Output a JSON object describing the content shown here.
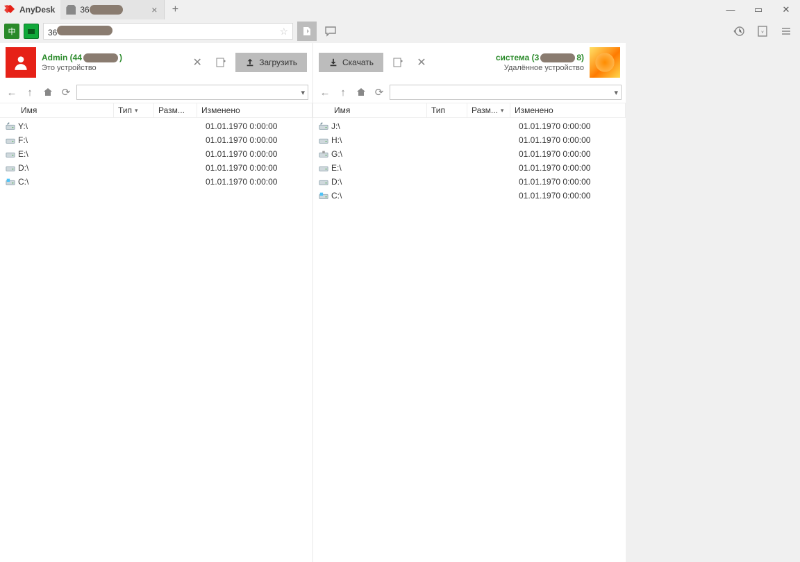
{
  "app_name": "AnyDesk",
  "tab_label_prefix": "36",
  "address_prefix": "36",
  "window_controls": {
    "min": "—",
    "max": "▭",
    "close": "✕"
  },
  "left": {
    "user_name_prefix": "Admin (44",
    "user_name_suffix": ")",
    "device_label": "Это устройство",
    "transfer_label": "Загрузить",
    "columns": {
      "name": "Имя",
      "type": "Тип",
      "size": "Разм...",
      "modified": "Изменено"
    },
    "drives": [
      {
        "name": "Y:\\",
        "kind": "net",
        "modified": "01.01.1970 0:00:00"
      },
      {
        "name": "F:\\",
        "kind": "disk",
        "modified": "01.01.1970 0:00:00"
      },
      {
        "name": "E:\\",
        "kind": "disk",
        "modified": "01.01.1970 0:00:00"
      },
      {
        "name": "D:\\",
        "kind": "disk",
        "modified": "01.01.1970 0:00:00"
      },
      {
        "name": "C:\\",
        "kind": "sys",
        "modified": "01.01.1970 0:00:00"
      }
    ]
  },
  "right": {
    "user_name_prefix": "система (3",
    "user_name_suffix": "8)",
    "device_label": "Удалённое устройство",
    "transfer_label": "Скачать",
    "columns": {
      "name": "Имя",
      "type": "Тип",
      "size": "Разм...",
      "modified": "Изменено"
    },
    "drives": [
      {
        "name": "J:\\",
        "kind": "net",
        "modified": "01.01.1970 0:00:00"
      },
      {
        "name": "H:\\",
        "kind": "disk",
        "modified": "01.01.1970 0:00:00"
      },
      {
        "name": "G:\\",
        "kind": "usb",
        "modified": "01.01.1970 0:00:00"
      },
      {
        "name": "E:\\",
        "kind": "disk",
        "modified": "01.01.1970 0:00:00"
      },
      {
        "name": "D:\\",
        "kind": "disk",
        "modified": "01.01.1970 0:00:00"
      },
      {
        "name": "C:\\",
        "kind": "sys",
        "modified": "01.01.1970 0:00:00"
      }
    ]
  }
}
